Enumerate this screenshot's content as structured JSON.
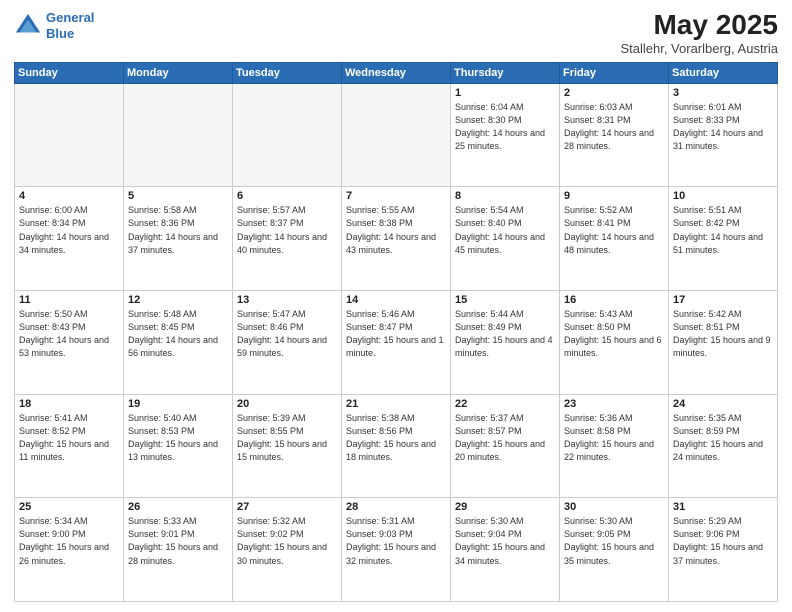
{
  "logo": {
    "line1": "General",
    "line2": "Blue"
  },
  "title": "May 2025",
  "subtitle": "Stallehr, Vorarlberg, Austria",
  "days_of_week": [
    "Sunday",
    "Monday",
    "Tuesday",
    "Wednesday",
    "Thursday",
    "Friday",
    "Saturday"
  ],
  "weeks": [
    [
      {
        "day": "",
        "info": ""
      },
      {
        "day": "",
        "info": ""
      },
      {
        "day": "",
        "info": ""
      },
      {
        "day": "",
        "info": ""
      },
      {
        "day": "1",
        "info": "Sunrise: 6:04 AM\nSunset: 8:30 PM\nDaylight: 14 hours\nand 25 minutes."
      },
      {
        "day": "2",
        "info": "Sunrise: 6:03 AM\nSunset: 8:31 PM\nDaylight: 14 hours\nand 28 minutes."
      },
      {
        "day": "3",
        "info": "Sunrise: 6:01 AM\nSunset: 8:33 PM\nDaylight: 14 hours\nand 31 minutes."
      }
    ],
    [
      {
        "day": "4",
        "info": "Sunrise: 6:00 AM\nSunset: 8:34 PM\nDaylight: 14 hours\nand 34 minutes."
      },
      {
        "day": "5",
        "info": "Sunrise: 5:58 AM\nSunset: 8:36 PM\nDaylight: 14 hours\nand 37 minutes."
      },
      {
        "day": "6",
        "info": "Sunrise: 5:57 AM\nSunset: 8:37 PM\nDaylight: 14 hours\nand 40 minutes."
      },
      {
        "day": "7",
        "info": "Sunrise: 5:55 AM\nSunset: 8:38 PM\nDaylight: 14 hours\nand 43 minutes."
      },
      {
        "day": "8",
        "info": "Sunrise: 5:54 AM\nSunset: 8:40 PM\nDaylight: 14 hours\nand 45 minutes."
      },
      {
        "day": "9",
        "info": "Sunrise: 5:52 AM\nSunset: 8:41 PM\nDaylight: 14 hours\nand 48 minutes."
      },
      {
        "day": "10",
        "info": "Sunrise: 5:51 AM\nSunset: 8:42 PM\nDaylight: 14 hours\nand 51 minutes."
      }
    ],
    [
      {
        "day": "11",
        "info": "Sunrise: 5:50 AM\nSunset: 8:43 PM\nDaylight: 14 hours\nand 53 minutes."
      },
      {
        "day": "12",
        "info": "Sunrise: 5:48 AM\nSunset: 8:45 PM\nDaylight: 14 hours\nand 56 minutes."
      },
      {
        "day": "13",
        "info": "Sunrise: 5:47 AM\nSunset: 8:46 PM\nDaylight: 14 hours\nand 59 minutes."
      },
      {
        "day": "14",
        "info": "Sunrise: 5:46 AM\nSunset: 8:47 PM\nDaylight: 15 hours\nand 1 minute."
      },
      {
        "day": "15",
        "info": "Sunrise: 5:44 AM\nSunset: 8:49 PM\nDaylight: 15 hours\nand 4 minutes."
      },
      {
        "day": "16",
        "info": "Sunrise: 5:43 AM\nSunset: 8:50 PM\nDaylight: 15 hours\nand 6 minutes."
      },
      {
        "day": "17",
        "info": "Sunrise: 5:42 AM\nSunset: 8:51 PM\nDaylight: 15 hours\nand 9 minutes."
      }
    ],
    [
      {
        "day": "18",
        "info": "Sunrise: 5:41 AM\nSunset: 8:52 PM\nDaylight: 15 hours\nand 11 minutes."
      },
      {
        "day": "19",
        "info": "Sunrise: 5:40 AM\nSunset: 8:53 PM\nDaylight: 15 hours\nand 13 minutes."
      },
      {
        "day": "20",
        "info": "Sunrise: 5:39 AM\nSunset: 8:55 PM\nDaylight: 15 hours\nand 15 minutes."
      },
      {
        "day": "21",
        "info": "Sunrise: 5:38 AM\nSunset: 8:56 PM\nDaylight: 15 hours\nand 18 minutes."
      },
      {
        "day": "22",
        "info": "Sunrise: 5:37 AM\nSunset: 8:57 PM\nDaylight: 15 hours\nand 20 minutes."
      },
      {
        "day": "23",
        "info": "Sunrise: 5:36 AM\nSunset: 8:58 PM\nDaylight: 15 hours\nand 22 minutes."
      },
      {
        "day": "24",
        "info": "Sunrise: 5:35 AM\nSunset: 8:59 PM\nDaylight: 15 hours\nand 24 minutes."
      }
    ],
    [
      {
        "day": "25",
        "info": "Sunrise: 5:34 AM\nSunset: 9:00 PM\nDaylight: 15 hours\nand 26 minutes."
      },
      {
        "day": "26",
        "info": "Sunrise: 5:33 AM\nSunset: 9:01 PM\nDaylight: 15 hours\nand 28 minutes."
      },
      {
        "day": "27",
        "info": "Sunrise: 5:32 AM\nSunset: 9:02 PM\nDaylight: 15 hours\nand 30 minutes."
      },
      {
        "day": "28",
        "info": "Sunrise: 5:31 AM\nSunset: 9:03 PM\nDaylight: 15 hours\nand 32 minutes."
      },
      {
        "day": "29",
        "info": "Sunrise: 5:30 AM\nSunset: 9:04 PM\nDaylight: 15 hours\nand 34 minutes."
      },
      {
        "day": "30",
        "info": "Sunrise: 5:30 AM\nSunset: 9:05 PM\nDaylight: 15 hours\nand 35 minutes."
      },
      {
        "day": "31",
        "info": "Sunrise: 5:29 AM\nSunset: 9:06 PM\nDaylight: 15 hours\nand 37 minutes."
      }
    ]
  ]
}
